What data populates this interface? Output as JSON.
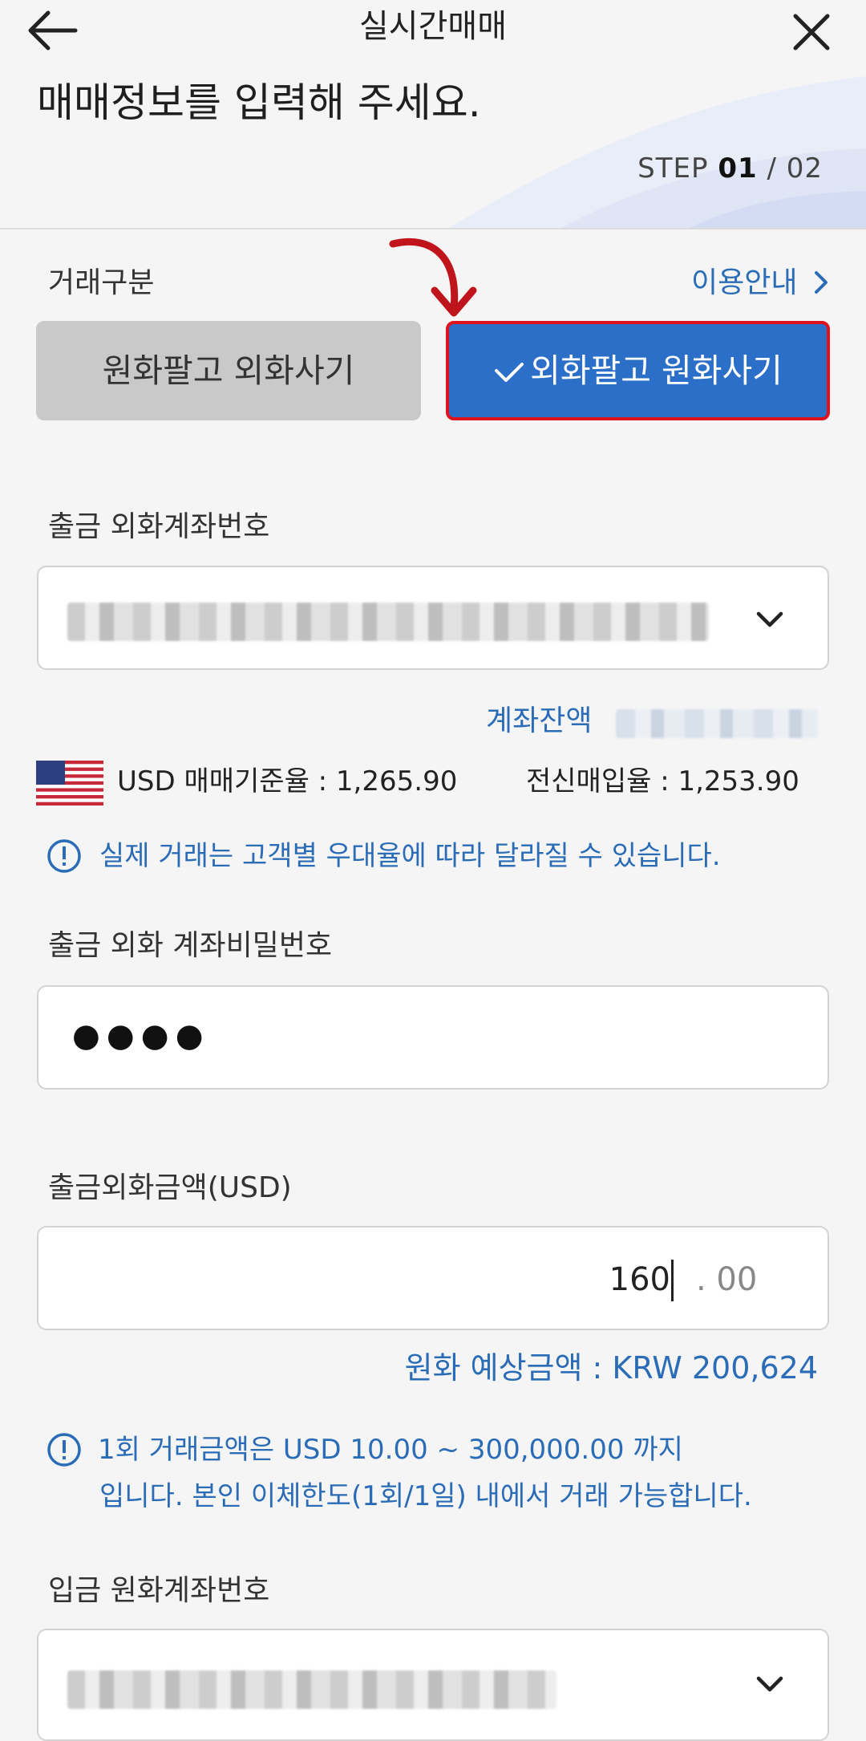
{
  "header": {
    "title": "실시간매매",
    "headline": "매매정보를 입력해 주세요.",
    "step_prefix": "STEP",
    "step_current": "01",
    "step_total": "/ 02"
  },
  "trade_type": {
    "label": "거래구분",
    "guide_link": "이용안내",
    "option_buy_foreign": "원화팔고 외화사기",
    "option_sell_foreign": "외화팔고 원화사기",
    "selected": "외화팔고 원화사기"
  },
  "withdraw_account": {
    "label": "출금 외화계좌번호",
    "balance_label": "계좌잔액"
  },
  "rates": {
    "currency": "USD",
    "base_rate_text": "USD 매매기준율 : 1,265.90",
    "tt_buying_text": "전신매입율 : 1,253.90",
    "notice": "실제 거래는 고객별 우대율에 따라 달라질 수 있습니다."
  },
  "password": {
    "label": "출금 외화 계좌비밀번호",
    "masked_value": "●●●●"
  },
  "amount": {
    "label": "출금외화금액(USD)",
    "integer_value": "160",
    "decimal_value": ". 00",
    "estimate": "원화 예상금액 : KRW 200,624",
    "notice_line1": "1회 거래금액은 USD 10.00 ~ 300,000.00 까지",
    "notice_line2": "입니다. 본인 이체한도(1회/1일) 내에서 거래 가능합니다."
  },
  "deposit_account": {
    "label": "입금 원화계좌번호"
  },
  "colors": {
    "accent_blue": "#2b6fc9",
    "link_blue": "#2b6cb6",
    "highlight_red": "#e0121d",
    "annotation_arrow": "#c0141c"
  }
}
